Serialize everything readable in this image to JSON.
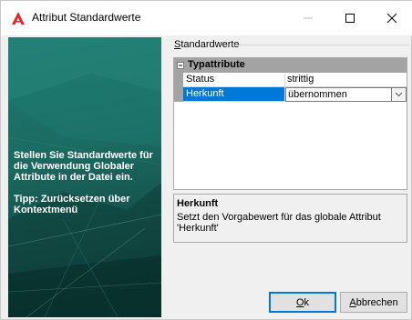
{
  "window": {
    "title": "Attribut Standardwerte",
    "icon": "autocad-a-icon",
    "controls": {
      "minimize": "—",
      "maximize": "☐",
      "close": "✕"
    }
  },
  "banner": {
    "text": "Stellen Sie Standardwerte für die Verwendung Globaler Attribute in der Datei ein.\n\nTipp: Zurücksetzen über Kontextmenü"
  },
  "group": {
    "label_accel": "S",
    "label_rest": "tandardwerte"
  },
  "grid": {
    "category": {
      "toggle": "−",
      "label": "Typattribute"
    },
    "rows": [
      {
        "name": "Status",
        "value": "strittig"
      },
      {
        "name": "Herkunft",
        "value": "übernommen"
      }
    ],
    "dropdown_icon": "chevron-down-icon"
  },
  "description": {
    "title": "Herkunft",
    "text": "Setzt den Vorgabewert für das globale Attribut 'Herkunft'"
  },
  "buttons": {
    "ok_accel": "O",
    "ok_rest": "k",
    "cancel_accel": "A",
    "cancel_rest": "bbrechen"
  },
  "colors": {
    "selection": "#0078d7",
    "banner": "#1b6b62",
    "app_icon": "#e4252b"
  }
}
